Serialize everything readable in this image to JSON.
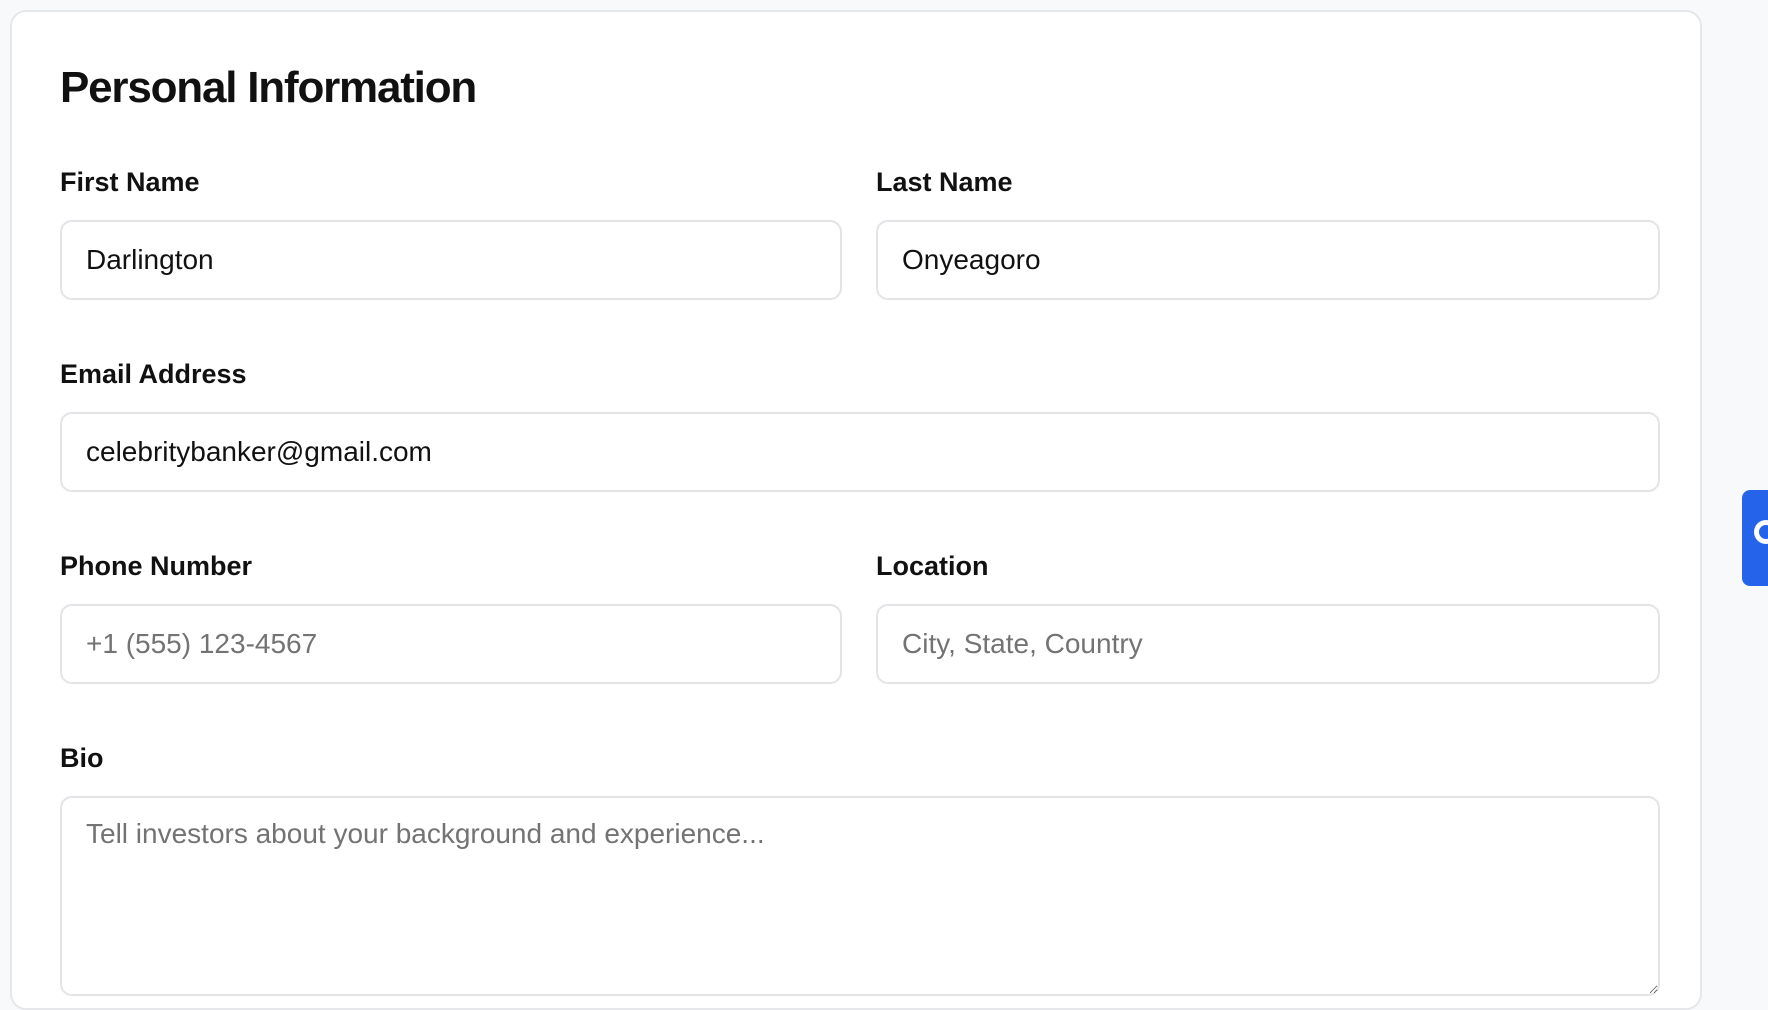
{
  "section": {
    "title": "Personal Information"
  },
  "fields": {
    "first_name": {
      "label": "First Name",
      "value": "Darlington",
      "placeholder": ""
    },
    "last_name": {
      "label": "Last Name",
      "value": "Onyeagoro",
      "placeholder": ""
    },
    "email": {
      "label": "Email Address",
      "value": "celebritybanker@gmail.com",
      "placeholder": ""
    },
    "phone": {
      "label": "Phone Number",
      "value": "",
      "placeholder": "+1 (555) 123-4567"
    },
    "location": {
      "label": "Location",
      "value": "",
      "placeholder": "City, State, Country"
    },
    "bio": {
      "label": "Bio",
      "value": "",
      "placeholder": "Tell investors about your background and experience..."
    }
  },
  "side_tab": {
    "icon": "chat-icon",
    "color": "#2563eb"
  }
}
